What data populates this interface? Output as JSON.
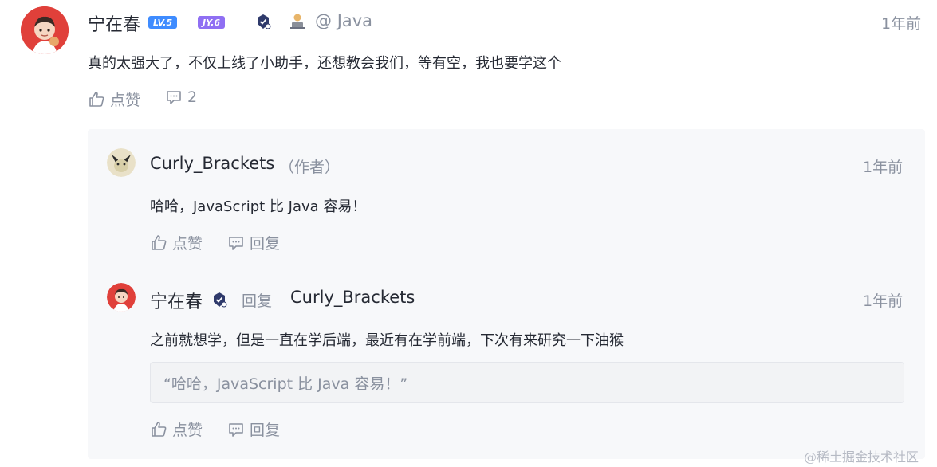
{
  "comment": {
    "author": "宁在春",
    "level_badge": "LV.5",
    "jy_badge": "JY.6",
    "tag_prefix": "@",
    "tag": "Java",
    "time": "1年前",
    "text": "真的太强大了，不仅上线了小助手，还想教会我们，等有空，我也要学这个",
    "like_label": "点赞",
    "comment_count": "2"
  },
  "replies": [
    {
      "author": "Curly_Brackets",
      "author_tag": "（作者）",
      "time": "1年前",
      "text": "哈哈，JavaScript 比 Java 容易！",
      "like_label": "点赞",
      "reply_label": "回复"
    },
    {
      "author": "宁在春",
      "reply_word": "回复",
      "reply_target": "Curly_Brackets",
      "time": "1年前",
      "text": "之前就想学，但是一直在学后端，最近有在学前端，下次有来研究一下油猴",
      "quote": "“哈哈，JavaScript 比 Java 容易！”",
      "like_label": "点赞",
      "reply_label": "回复"
    }
  ],
  "watermark": "@稀土掘金技术社区",
  "colors": {
    "text": "#252933",
    "muted": "#8a919f",
    "reply_bg": "#f7f8fa",
    "level_blue": "#3f8cff",
    "jy_purple": "#8f6ff3",
    "verified_navy": "#2f3a6b"
  }
}
